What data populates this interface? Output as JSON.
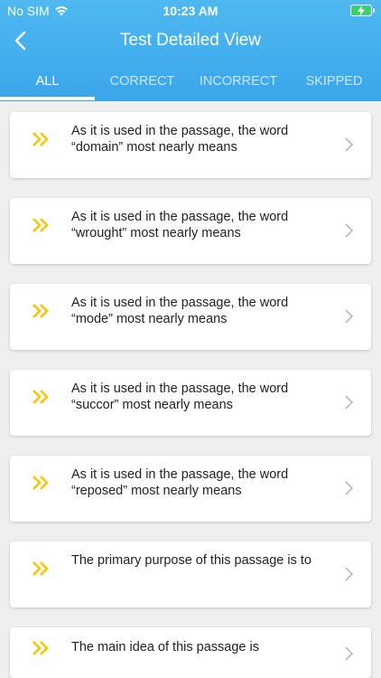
{
  "status_bar": {
    "carrier": "No SIM",
    "time": "10:23 AM"
  },
  "header": {
    "title": "Test Detailed View",
    "back_icon": "chevron-left-icon"
  },
  "tabs": [
    {
      "label": "ALL",
      "active": true
    },
    {
      "label": "CORRECT",
      "active": false
    },
    {
      "label": "INCORRECT",
      "active": false
    },
    {
      "label": "SKIPPED",
      "active": false
    }
  ],
  "questions": [
    {
      "text": "As it is used in the passage, the word “domain” most nearly means"
    },
    {
      "text": "As it is used in the passage, the word “wrought” most nearly means"
    },
    {
      "text": "As it is used in the passage, the word “mode” most nearly means"
    },
    {
      "text": "As it is used in the passage, the word “succor” most nearly means"
    },
    {
      "text": "As it is used in the passage, the word “reposed” most nearly means"
    },
    {
      "text": "The primary purpose of this passage is to"
    },
    {
      "text": "The main idea of this passage is"
    }
  ],
  "colors": {
    "header": "#3aa6ea",
    "accent_icon": "#f6c400",
    "background": "#efefef"
  }
}
